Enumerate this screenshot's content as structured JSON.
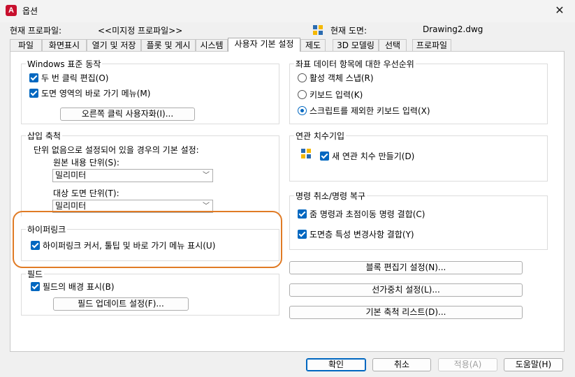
{
  "window": {
    "title": "옵션",
    "app_icon_letter": "A"
  },
  "header": {
    "profile_label": "현재 프로파일:",
    "profile_value": "<<미지정 프로파일>>",
    "drawing_label": "현재 도면:",
    "drawing_value": "Drawing2.dwg"
  },
  "tabs": [
    "파일",
    "화면표시",
    "열기 및 저장",
    "플롯 및 게시",
    "시스템",
    "사용자 기본 설정",
    "제도",
    "3D 모델링",
    "선택",
    "프로파일"
  ],
  "active_tab": "사용자 기본 설정",
  "windows_behavior": {
    "title": "Windows 표준 동작",
    "double_click_edit": "두 번 클릭 편집(O)",
    "shortcut_menu": "도면 영역의 바로 가기 메뉴(M)",
    "right_click_button": "오른쪽 클릭 사용자화(I)..."
  },
  "insertion_scale": {
    "title": "삽입 축척",
    "description": "단위 없음으로 설정되어 있을 경우의 기본 설정:",
    "source_label": "원본 내용 단위(S):",
    "source_value": "밀리미터",
    "target_label": "대상 도면 단위(T):",
    "target_value": "밀리미터"
  },
  "hyperlink": {
    "title": "하이퍼링크",
    "show_option": "하이퍼링크 커서, 툴팁 및 바로 가기 메뉴 표시(U)"
  },
  "fields": {
    "title": "필드",
    "show_background": "필드의 배경 표시(B)",
    "update_settings_button": "필드 업데이트 설정(F)..."
  },
  "coordinate_priority": {
    "title": "좌표 데이터 항목에 대한 우선순위",
    "options": [
      "활성 객체 스냅(R)",
      "키보드 입력(K)",
      "스크립트를 제외한 키보드 입력(X)"
    ],
    "selected": "스크립트를 제외한 키보드 입력(X)"
  },
  "associative_dim": {
    "title": "연관 치수기입",
    "make_new": "새 연관 치수 만들기(D)"
  },
  "undo_redo": {
    "title": "명령 취소/명령 복구",
    "combine_zoom_pan": "줌 명령과 초점이동 명령 결합(C)",
    "combine_layer": "도면층 특성 변경사항 결합(Y)"
  },
  "side_buttons": {
    "block_editor": "블록 편집기 설정(N)...",
    "lineweight": "선가중치 설정(L)...",
    "scale_list": "기본 축척 리스트(D)..."
  },
  "footer": {
    "ok": "확인",
    "cancel": "취소",
    "apply": "적용(A)",
    "help": "도움말(H)"
  },
  "colors": {
    "accent": "#0067c0",
    "highlight": "#e07b25"
  }
}
